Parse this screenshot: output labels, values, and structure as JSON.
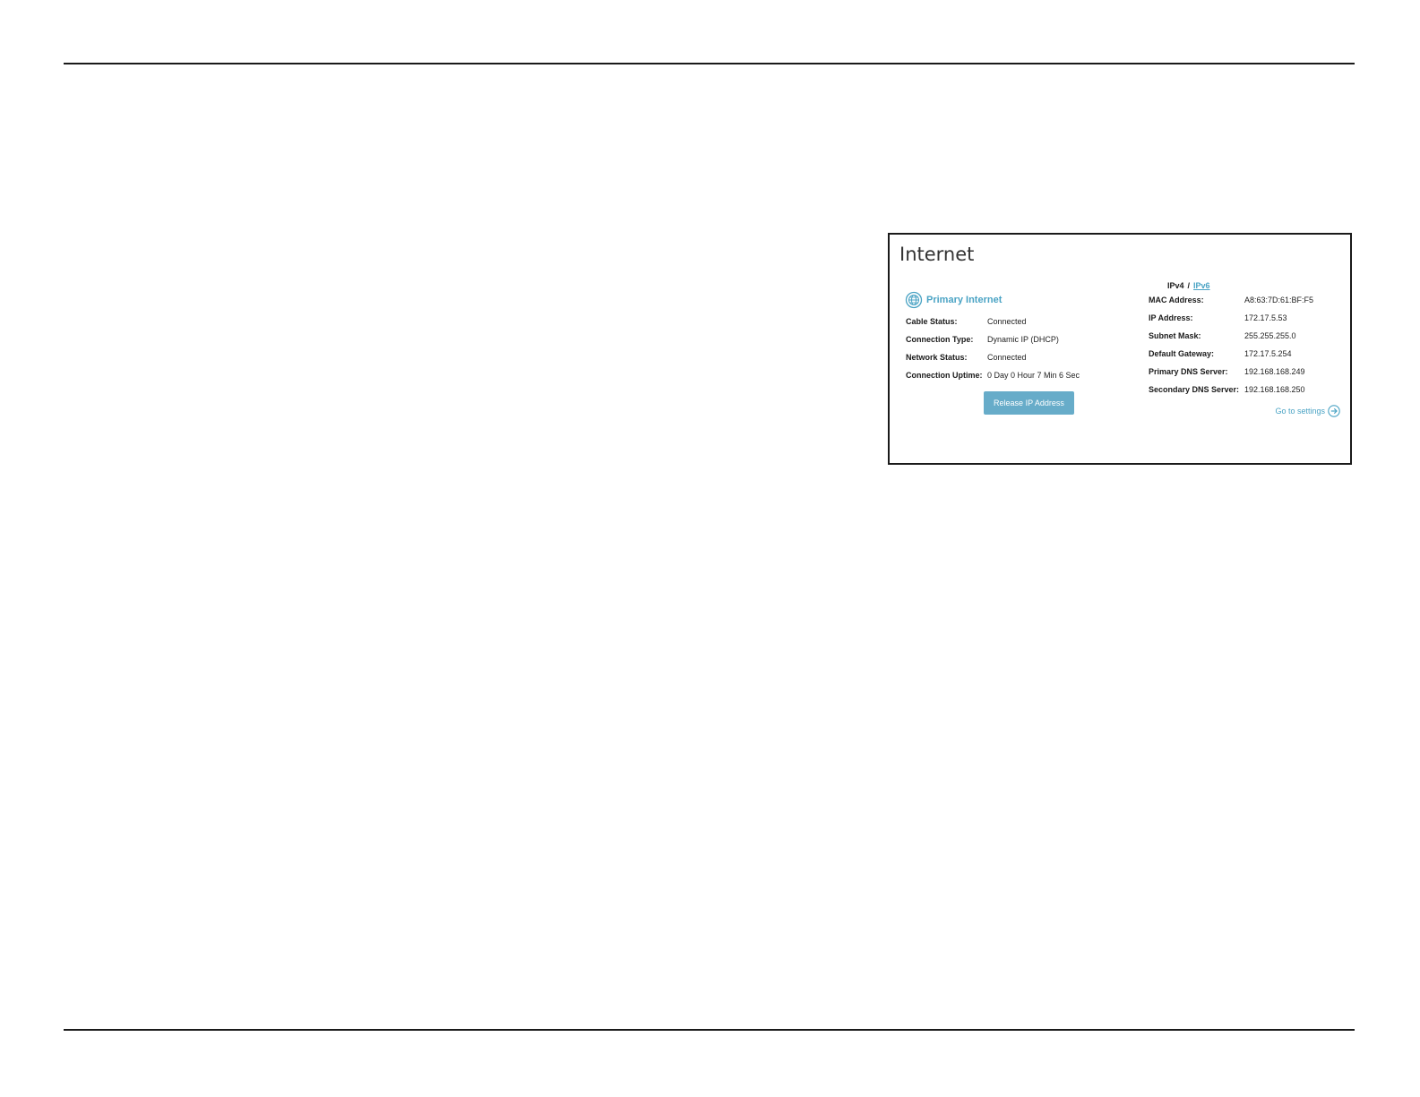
{
  "panel": {
    "title": "Internet",
    "primary_label": "Primary Internet",
    "left_rows": [
      {
        "key": "Cable Status:",
        "value": "Connected"
      },
      {
        "key": "Connection Type:",
        "value": "Dynamic IP (DHCP)"
      },
      {
        "key": "Network Status:",
        "value": "Connected"
      },
      {
        "key": "Connection Uptime:",
        "value": "0 Day 0 Hour 7 Min 6 Sec"
      }
    ],
    "release_button": "Release IP Address",
    "ip_switch": {
      "ipv4": "IPv4",
      "separator": "/",
      "ipv6": "IPv6"
    },
    "right_rows": [
      {
        "key": "MAC Address:",
        "value": "A8:63:7D:61:BF:F5"
      },
      {
        "key": "IP Address:",
        "value": "172.17.5.53"
      },
      {
        "key": "Subnet Mask:",
        "value": "255.255.255.0"
      },
      {
        "key": "Default Gateway:",
        "value": "172.17.5.254"
      },
      {
        "key": "Primary DNS Server:",
        "value": "192.168.168.249"
      },
      {
        "key": "Secondary DNS Server:",
        "value": "192.168.168.250"
      }
    ],
    "go_to_settings": "Go to settings"
  },
  "icons": {
    "globe": "globe-icon",
    "arrow": "arrow-right-circle-icon"
  },
  "colors": {
    "accent": "#4aa3c4",
    "button": "#67acc9",
    "text": "#1a1a1a"
  }
}
